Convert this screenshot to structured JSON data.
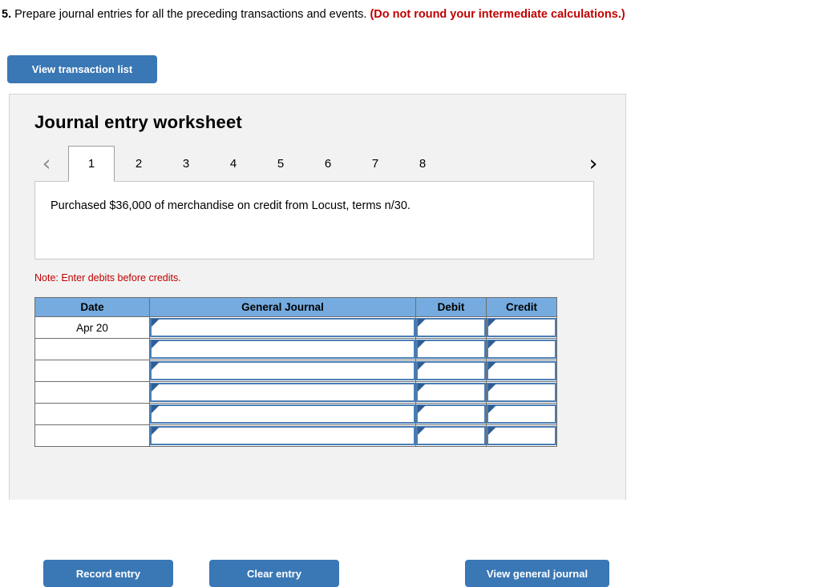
{
  "question": {
    "number": "5.",
    "text": "Prepare journal entries for all the preceding transactions and events.",
    "warning": "(Do not round your intermediate calculations.)"
  },
  "toolbar": {
    "view_transaction_list": "View transaction list"
  },
  "panel": {
    "title": "Journal entry worksheet"
  },
  "tabs": {
    "prev_icon": "‹",
    "next_icon": "›",
    "items": [
      {
        "label": "1",
        "active": true
      },
      {
        "label": "2",
        "active": false
      },
      {
        "label": "3",
        "active": false
      },
      {
        "label": "4",
        "active": false
      },
      {
        "label": "5",
        "active": false
      },
      {
        "label": "6",
        "active": false
      },
      {
        "label": "7",
        "active": false
      },
      {
        "label": "8",
        "active": false
      }
    ]
  },
  "description": {
    "text": "Purchased $36,000 of merchandise on credit from Locust, terms n/30."
  },
  "note": {
    "text": "Note: Enter debits before credits."
  },
  "journal_table": {
    "headers": [
      "Date",
      "General Journal",
      "Debit",
      "Credit"
    ],
    "rows": [
      {
        "date": "Apr 20",
        "general_journal": "",
        "debit": "",
        "credit": ""
      },
      {
        "date": "",
        "general_journal": "",
        "debit": "",
        "credit": ""
      },
      {
        "date": "",
        "general_journal": "",
        "debit": "",
        "credit": ""
      },
      {
        "date": "",
        "general_journal": "",
        "debit": "",
        "credit": ""
      },
      {
        "date": "",
        "general_journal": "",
        "debit": "",
        "credit": ""
      },
      {
        "date": "",
        "general_journal": "",
        "debit": "",
        "credit": ""
      }
    ]
  },
  "actions": {
    "record_entry": "Record entry",
    "clear_entry": "Clear entry",
    "view_general_journal": "View general journal"
  },
  "colors": {
    "button_blue": "#3A77B5",
    "table_header_blue": "#75ABDF",
    "input_border_blue": "#4A7EB5",
    "marker_blue": "#2E5E96",
    "warning_red": "#C00000",
    "panel_gray": "#F2F2F2"
  }
}
